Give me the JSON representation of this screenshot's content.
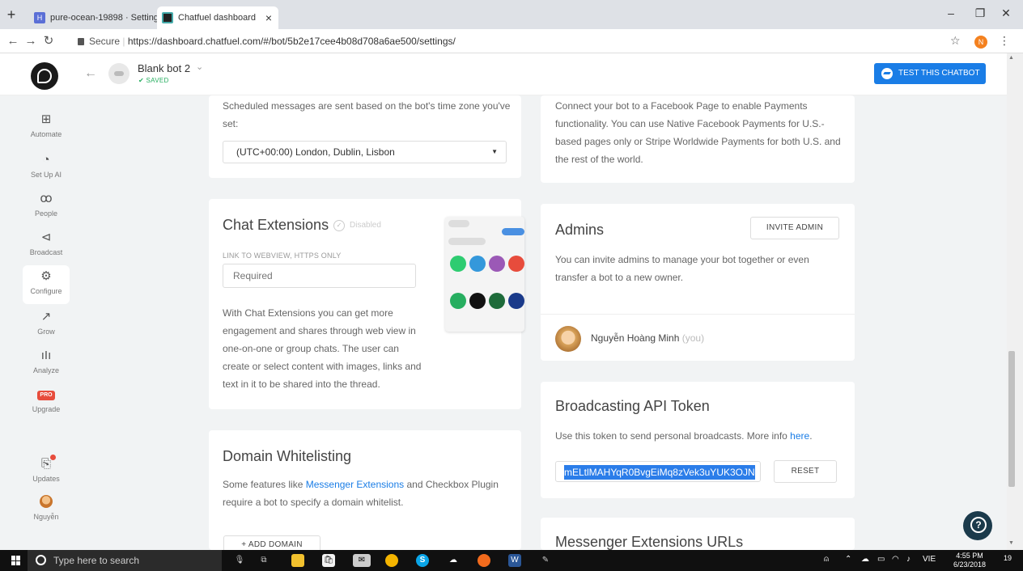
{
  "browser": {
    "tabs": [
      {
        "label": "pure-ocean-19898 · Settings"
      },
      {
        "label": "Chatfuel dashboard"
      }
    ],
    "tab_close": "×",
    "new_tab": "+",
    "url_secure": "Secure",
    "url": "https://dashboard.chatfuel.com/#/bot/5b2e17cee4b08d708a6ae500/settings/",
    "profile_initial": "N"
  },
  "header": {
    "bot_name": "Blank bot 2",
    "saved_label": "✔ SAVED",
    "test_button": "TEST THIS CHATBOT"
  },
  "sidebar": {
    "items": [
      {
        "label": "Automate",
        "icon": "automate-icon"
      },
      {
        "label": "Set Up AI",
        "icon": "ai-icon"
      },
      {
        "label": "People",
        "icon": "people-icon"
      },
      {
        "label": "Broadcast",
        "icon": "megaphone-icon"
      },
      {
        "label": "Configure",
        "icon": "gear-icon"
      },
      {
        "label": "Grow",
        "icon": "grow-icon"
      },
      {
        "label": "Analyze",
        "icon": "chart-icon"
      },
      {
        "label": "Upgrade",
        "icon": "pro-icon"
      },
      {
        "label": "Updates",
        "icon": "updates-icon"
      },
      {
        "label": "Nguyễn",
        "icon": "user-avatar"
      }
    ],
    "pro_badge": "PRO"
  },
  "timezone": {
    "text": "Scheduled messages are sent based on the bot's time zone you've set:",
    "selected": "(UTC+00:00) London, Dublin, Lisbon"
  },
  "payments": {
    "text": "Connect your bot to a Facebook Page to enable Payments functionality. You can use Native Facebook Payments for U.S.-based pages only or Stripe Worldwide Payments for both U.S. and the rest of the world."
  },
  "chat_extensions": {
    "title": "Chat Extensions",
    "status": "Disabled",
    "field_label": "LINK TO WEBVIEW, HTTPS ONLY",
    "placeholder": "Required",
    "description": "With Chat Extensions you can get more engagement and shares through web view in one-on-one or group chats. The user can create or select content with images, links and text in it to be shared into the thread."
  },
  "admins": {
    "title": "Admins",
    "invite_button": "INVITE ADMIN",
    "text": "You can invite admins to manage your bot together or even transfer a bot to a new owner.",
    "admin_name": "Nguyễn Hoàng Minh",
    "admin_you": "(you)"
  },
  "broadcast_api": {
    "title": "Broadcasting API Token",
    "text_prefix": "Use this token to send personal broadcasts. More info",
    "link": "here",
    "text_suffix": ".",
    "token": "mELtlMAHYqR0BvgEiMq8zVek3uYUK3OJN",
    "reset_button": "RESET"
  },
  "domain_whitelisting": {
    "title": "Domain Whitelisting",
    "text_prefix": "Some features like",
    "link1": "Messenger Extensions",
    "text_middle": "and Checkbox Plugin require a bot to specify a domain whitelist.",
    "add_button": "+ ADD DOMAIN"
  },
  "messenger_ext_urls": {
    "title": "Messenger Extensions URLs"
  },
  "taskbar": {
    "search_placeholder": "Type here to search",
    "lang": "VIE",
    "time": "4:55 PM",
    "date": "6/23/2018",
    "notif_count": "19"
  },
  "colors": {
    "accent": "#1a7de6",
    "saved": "#27ae60",
    "pro": "#e74c3c"
  }
}
